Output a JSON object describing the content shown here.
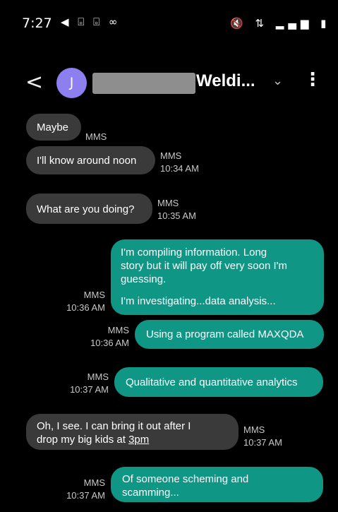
{
  "status_bar": {
    "time": "7:27",
    "left_icons": "◀ ⌻ ⌻ ∞",
    "right_icons": "🔇 ⇅ ▂▄▆ ▮"
  },
  "header": {
    "back_icon": "<",
    "avatar_letter": "J",
    "contact_name": "Weldi...",
    "chevron": "⌄",
    "more": "⋮"
  },
  "messages": [
    {
      "direction": "in",
      "text": "Maybe",
      "meta_type": "MMS",
      "meta_time": ""
    },
    {
      "direction": "in",
      "text": "I'll know around noon",
      "meta_type": "MMS",
      "meta_time": "10:34 AM"
    },
    {
      "direction": "in",
      "text": "What are you doing?",
      "meta_type": "MMS",
      "meta_time": "10:35 AM"
    },
    {
      "direction": "out",
      "text_line1": "I'm compiling information. Long",
      "text_line2": "story but it will pay off very soon I'm",
      "text_line3": "guessing.",
      "text_line4": "I'm investigating...data analysis...",
      "meta_type": "MMS",
      "meta_time": "10:36 AM"
    },
    {
      "direction": "out",
      "text": "Using a program called MAXQDA",
      "meta_type": "MMS",
      "meta_time": "10:36 AM"
    },
    {
      "direction": "out",
      "text": "Qualitative and quantitative analytics",
      "meta_type": "MMS",
      "meta_time": "10:37 AM"
    },
    {
      "direction": "in",
      "text_line1": "Oh, I see.  I can bring it out after I",
      "text_line2": "drop my big kids at ",
      "text_link": "3pm",
      "meta_type": "MMS",
      "meta_time": "10:37 AM"
    },
    {
      "direction": "out",
      "text_line1": "Of someone scheming and",
      "text_line2": "scamming...",
      "meta_type": "MMS",
      "meta_time": "10:37 AM"
    }
  ],
  "colors": {
    "incoming": "#3a3a3a",
    "outgoing": "#0f9685",
    "avatar": "#8d7ff0"
  }
}
